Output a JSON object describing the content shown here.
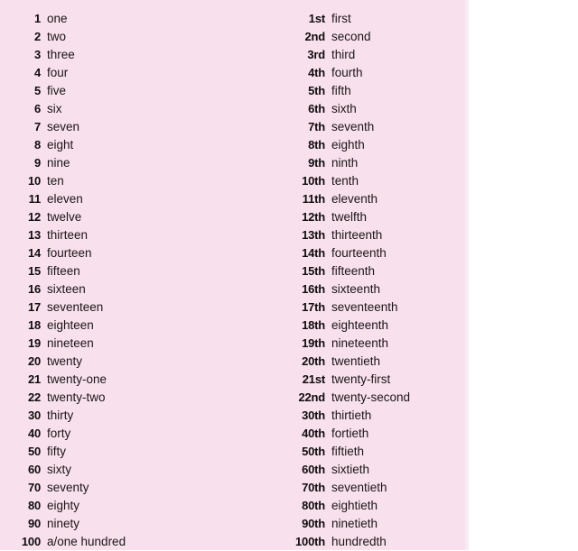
{
  "page": {
    "background_color": "#ffffff",
    "panel_color": "#f8e1ec",
    "text_color": "#100c0e"
  },
  "columns": {
    "cardinal": {
      "name": "cardinal-numbers-column",
      "rows": [
        {
          "figure": "1",
          "word": "one"
        },
        {
          "figure": "2",
          "word": "two"
        },
        {
          "figure": "3",
          "word": "three"
        },
        {
          "figure": "4",
          "word": "four"
        },
        {
          "figure": "5",
          "word": "five"
        },
        {
          "figure": "6",
          "word": "six"
        },
        {
          "figure": "7",
          "word": "seven"
        },
        {
          "figure": "8",
          "word": "eight"
        },
        {
          "figure": "9",
          "word": "nine"
        },
        {
          "figure": "10",
          "word": "ten"
        },
        {
          "figure": "11",
          "word": "eleven"
        },
        {
          "figure": "12",
          "word": "twelve"
        },
        {
          "figure": "13",
          "word": "thirteen"
        },
        {
          "figure": "14",
          "word": "fourteen"
        },
        {
          "figure": "15",
          "word": "fifteen"
        },
        {
          "figure": "16",
          "word": "sixteen"
        },
        {
          "figure": "17",
          "word": "seventeen"
        },
        {
          "figure": "18",
          "word": "eighteen"
        },
        {
          "figure": "19",
          "word": "nineteen"
        },
        {
          "figure": "20",
          "word": "twenty"
        },
        {
          "figure": "21",
          "word": "twenty-one"
        },
        {
          "figure": "22",
          "word": "twenty-two"
        },
        {
          "figure": "30",
          "word": "thirty"
        },
        {
          "figure": "40",
          "word": "forty"
        },
        {
          "figure": "50",
          "word": "fifty"
        },
        {
          "figure": "60",
          "word": "sixty"
        },
        {
          "figure": "70",
          "word": "seventy"
        },
        {
          "figure": "80",
          "word": "eighty"
        },
        {
          "figure": "90",
          "word": "ninety"
        },
        {
          "figure": "100",
          "word": "a/one hundred"
        }
      ]
    },
    "ordinal": {
      "name": "ordinal-numbers-column",
      "rows": [
        {
          "figure": "1st",
          "word": "first"
        },
        {
          "figure": "2nd",
          "word": "second"
        },
        {
          "figure": "3rd",
          "word": "third"
        },
        {
          "figure": "4th",
          "word": "fourth"
        },
        {
          "figure": "5th",
          "word": "fifth"
        },
        {
          "figure": "6th",
          "word": "sixth"
        },
        {
          "figure": "7th",
          "word": "seventh"
        },
        {
          "figure": "8th",
          "word": "eighth"
        },
        {
          "figure": "9th",
          "word": "ninth"
        },
        {
          "figure": "10th",
          "word": "tenth"
        },
        {
          "figure": "11th",
          "word": "eleventh"
        },
        {
          "figure": "12th",
          "word": "twelfth"
        },
        {
          "figure": "13th",
          "word": "thirteenth"
        },
        {
          "figure": "14th",
          "word": "fourteenth"
        },
        {
          "figure": "15th",
          "word": "fifteenth"
        },
        {
          "figure": "16th",
          "word": "sixteenth"
        },
        {
          "figure": "17th",
          "word": "seventeenth"
        },
        {
          "figure": "18th",
          "word": "eighteenth"
        },
        {
          "figure": "19th",
          "word": "nineteenth"
        },
        {
          "figure": "20th",
          "word": "twentieth"
        },
        {
          "figure": "21st",
          "word": "twenty-first"
        },
        {
          "figure": "22nd",
          "word": "twenty-second"
        },
        {
          "figure": "30th",
          "word": "thirtieth"
        },
        {
          "figure": "40th",
          "word": "fortieth"
        },
        {
          "figure": "50th",
          "word": "fiftieth"
        },
        {
          "figure": "60th",
          "word": "sixtieth"
        },
        {
          "figure": "70th",
          "word": "seventieth"
        },
        {
          "figure": "80th",
          "word": "eightieth"
        },
        {
          "figure": "90th",
          "word": "ninetieth"
        },
        {
          "figure": "100th",
          "word": "hundredth"
        }
      ]
    }
  }
}
